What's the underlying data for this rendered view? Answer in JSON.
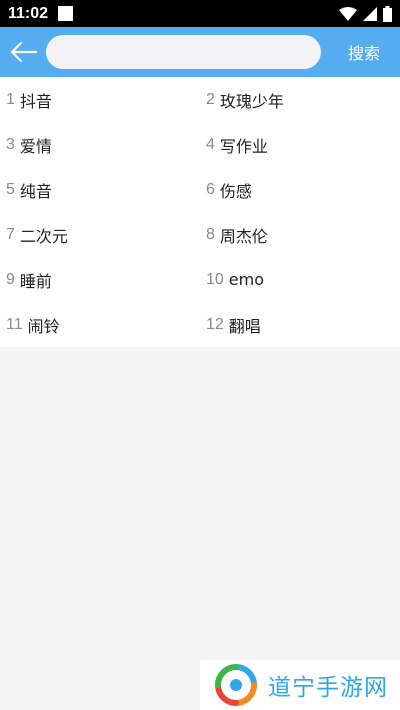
{
  "status_bar": {
    "time": "11:02"
  },
  "header": {
    "back_icon": "arrow-left-icon",
    "search_placeholder": "",
    "search_value": "",
    "search_label": "搜索",
    "accent_color": "#55acef"
  },
  "hot_list": {
    "items": [
      {
        "num": "1",
        "text": "抖音"
      },
      {
        "num": "2",
        "text": "玫瑰少年"
      },
      {
        "num": "3",
        "text": "爱情"
      },
      {
        "num": "4",
        "text": "写作业"
      },
      {
        "num": "5",
        "text": "纯音"
      },
      {
        "num": "6",
        "text": "伤感"
      },
      {
        "num": "7",
        "text": "二次元"
      },
      {
        "num": "8",
        "text": "周杰伦"
      },
      {
        "num": "9",
        "text": "睡前"
      },
      {
        "num": "10",
        "text": "emo"
      },
      {
        "num": "11",
        "text": "闹铃"
      },
      {
        "num": "12",
        "text": "翻唱"
      }
    ]
  },
  "watermark": {
    "text": "道宁手游网"
  }
}
